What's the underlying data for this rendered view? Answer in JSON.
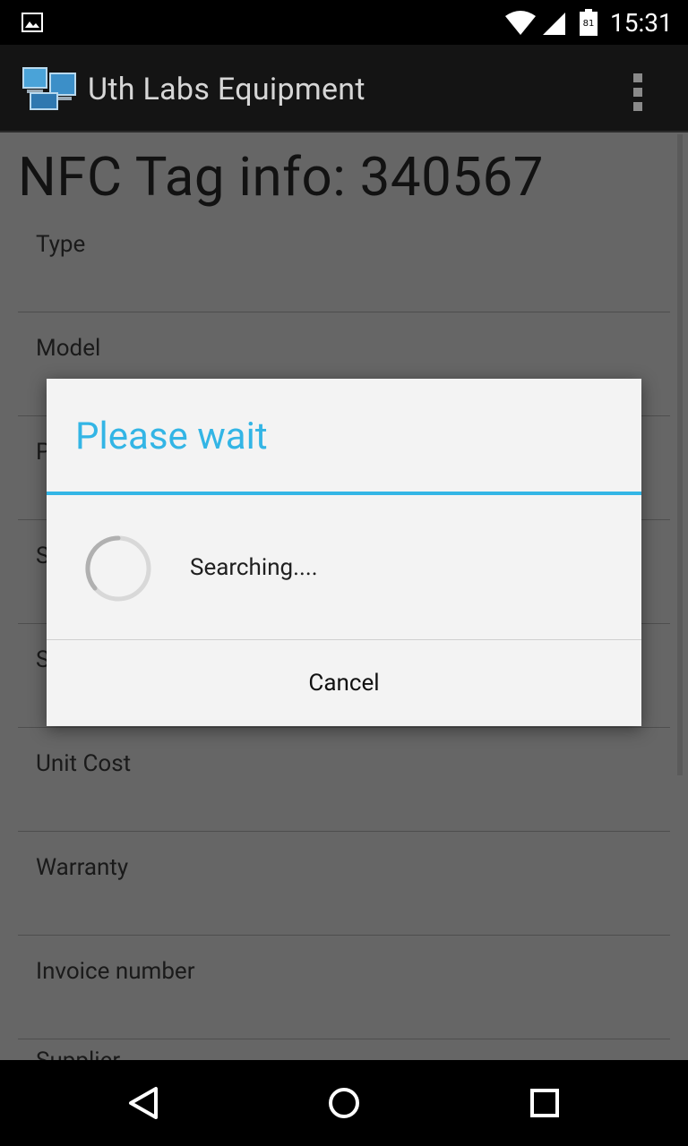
{
  "status_bar": {
    "battery_level": "81",
    "time": "15:31"
  },
  "action_bar": {
    "title": "Uth Labs Equipment",
    "icons": [
      "app-logo-icon",
      "overflow-menu-icon"
    ]
  },
  "page": {
    "title": "NFC Tag info:  340567",
    "fields": [
      {
        "label": "Type"
      },
      {
        "label": "Model"
      },
      {
        "label": "P"
      },
      {
        "label": "S"
      },
      {
        "label": "S"
      },
      {
        "label": "Unit Cost"
      },
      {
        "label": "Warranty"
      },
      {
        "label": "Invoice number"
      },
      {
        "label": "Supplier"
      }
    ]
  },
  "dialog": {
    "title": "Please wait",
    "message": "Searching....",
    "cancel_label": "Cancel",
    "accent_color": "#33b5e5"
  },
  "nav_bar": {
    "icons": [
      "back-icon",
      "home-icon",
      "recents-icon"
    ]
  }
}
